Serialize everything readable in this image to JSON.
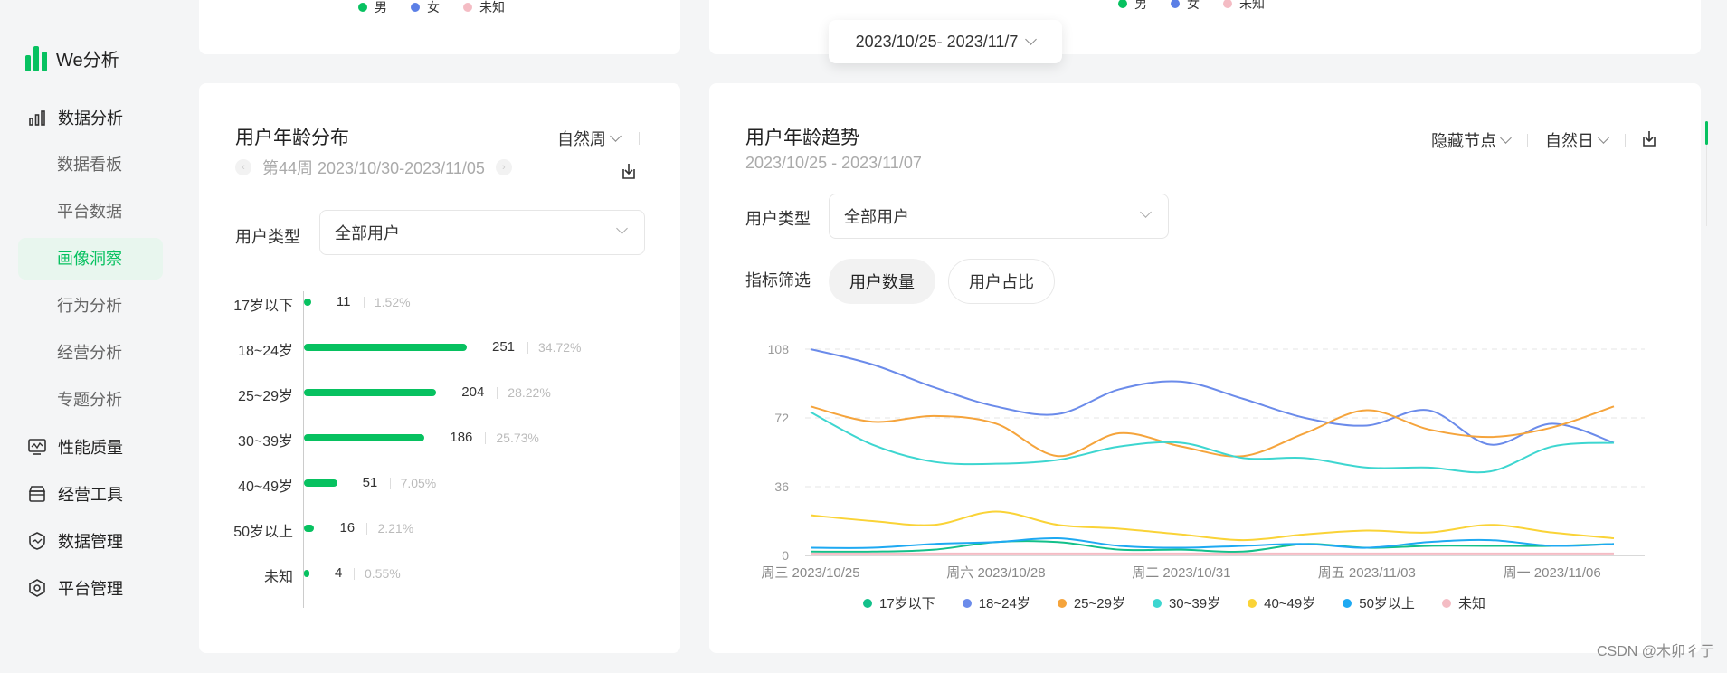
{
  "sidebar": {
    "logo_text": "We分析",
    "groups": [
      {
        "label": "数据分析",
        "icon": "bar-chart-icon"
      },
      {
        "label": "性能质量",
        "icon": "monitor-icon"
      },
      {
        "label": "经营工具",
        "icon": "shop-icon"
      },
      {
        "label": "数据管理",
        "icon": "shield-icon"
      },
      {
        "label": "平台管理",
        "icon": "hexagon-settings-icon"
      }
    ],
    "sub_items": [
      "数据看板",
      "平台数据",
      "画像洞察",
      "行为分析",
      "经营分析",
      "专题分析"
    ],
    "active_sub": "画像洞察"
  },
  "top_legend_left": [
    "男",
    "女",
    "未知"
  ],
  "top_legend_right": [
    "男",
    "女",
    "未知"
  ],
  "date_popover": "2023/10/25- 2023/11/7",
  "age_dist": {
    "title": "用户年龄分布",
    "period_label": "第44周 2023/10/30-2023/11/05",
    "granularity": "自然周",
    "user_type_label": "用户类型",
    "user_type_value": "全部用户",
    "rows": [
      {
        "label": "17岁以下",
        "value": 11,
        "pct": "1.52%"
      },
      {
        "label": "18~24岁",
        "value": 251,
        "pct": "34.72%"
      },
      {
        "label": "25~29岁",
        "value": 204,
        "pct": "28.22%"
      },
      {
        "label": "30~39岁",
        "value": 186,
        "pct": "25.73%"
      },
      {
        "label": "40~49岁",
        "value": 51,
        "pct": "7.05%"
      },
      {
        "label": "50岁以上",
        "value": 16,
        "pct": "2.21%"
      },
      {
        "label": "未知",
        "value": 4,
        "pct": "0.55%"
      }
    ]
  },
  "age_trend": {
    "title": "用户年龄趋势",
    "date_range": "2023/10/25 - 2023/11/07",
    "node_toggle": "隐藏节点",
    "granularity": "自然日",
    "user_type_label": "用户类型",
    "user_type_value": "全部用户",
    "metric_label": "指标筛选",
    "metric_on": "用户数量",
    "metric_off": "用户占比"
  },
  "colors": {
    "brand": "#07c160",
    "male": "#07c160",
    "female": "#5b7fe6",
    "unknown": "#f4bcc4"
  },
  "chart_data": {
    "type": "line",
    "x": [
      "2023/10/25",
      "2023/10/26",
      "2023/10/27",
      "2023/10/28",
      "2023/10/29",
      "2023/10/30",
      "2023/10/31",
      "2023/11/01",
      "2023/11/02",
      "2023/11/03",
      "2023/11/04",
      "2023/11/05",
      "2023/11/06",
      "2023/11/07"
    ],
    "tick_labels": [
      "周三 2023/10/25",
      "周六 2023/10/28",
      "周二 2023/10/31",
      "周五 2023/11/03",
      "周一 2023/11/06"
    ],
    "yticks": [
      0,
      36,
      72,
      108
    ],
    "ylim": [
      0,
      108
    ],
    "grid": true,
    "legend_position": "bottom",
    "series": [
      {
        "name": "17岁以下",
        "color": "#13c08a",
        "values": [
          2,
          2,
          3,
          7,
          7,
          3,
          3,
          2,
          6,
          4,
          5,
          5,
          5,
          6
        ]
      },
      {
        "name": "18~24岁",
        "color": "#6b8bea",
        "values": [
          108,
          100,
          88,
          78,
          74,
          87,
          91,
          82,
          72,
          68,
          76,
          58,
          69,
          59
        ]
      },
      {
        "name": "25~29岁",
        "color": "#f5a43c",
        "values": [
          78,
          70,
          73,
          69,
          52,
          64,
          57,
          52,
          64,
          76,
          66,
          62,
          67,
          78
        ]
      },
      {
        "name": "30~39岁",
        "color": "#3dd6d0",
        "values": [
          75,
          58,
          49,
          48,
          50,
          57,
          59,
          51,
          51,
          46,
          46,
          44,
          57,
          59
        ]
      },
      {
        "name": "40~49岁",
        "color": "#fad337",
        "values": [
          21,
          18,
          16,
          23,
          16,
          14,
          11,
          8,
          11,
          13,
          12,
          16,
          12,
          9
        ]
      },
      {
        "name": "50岁以上",
        "color": "#1ea9f2",
        "values": [
          4,
          4,
          6,
          7,
          9,
          5,
          4,
          5,
          6,
          4,
          7,
          8,
          5,
          6
        ]
      },
      {
        "name": "未知",
        "color": "#f4bcc4",
        "values": [
          1,
          1,
          1,
          1,
          1,
          1,
          1,
          1,
          1,
          1,
          1,
          1,
          1,
          1
        ]
      }
    ]
  },
  "watermark": "CSDN @木卯彳亍"
}
